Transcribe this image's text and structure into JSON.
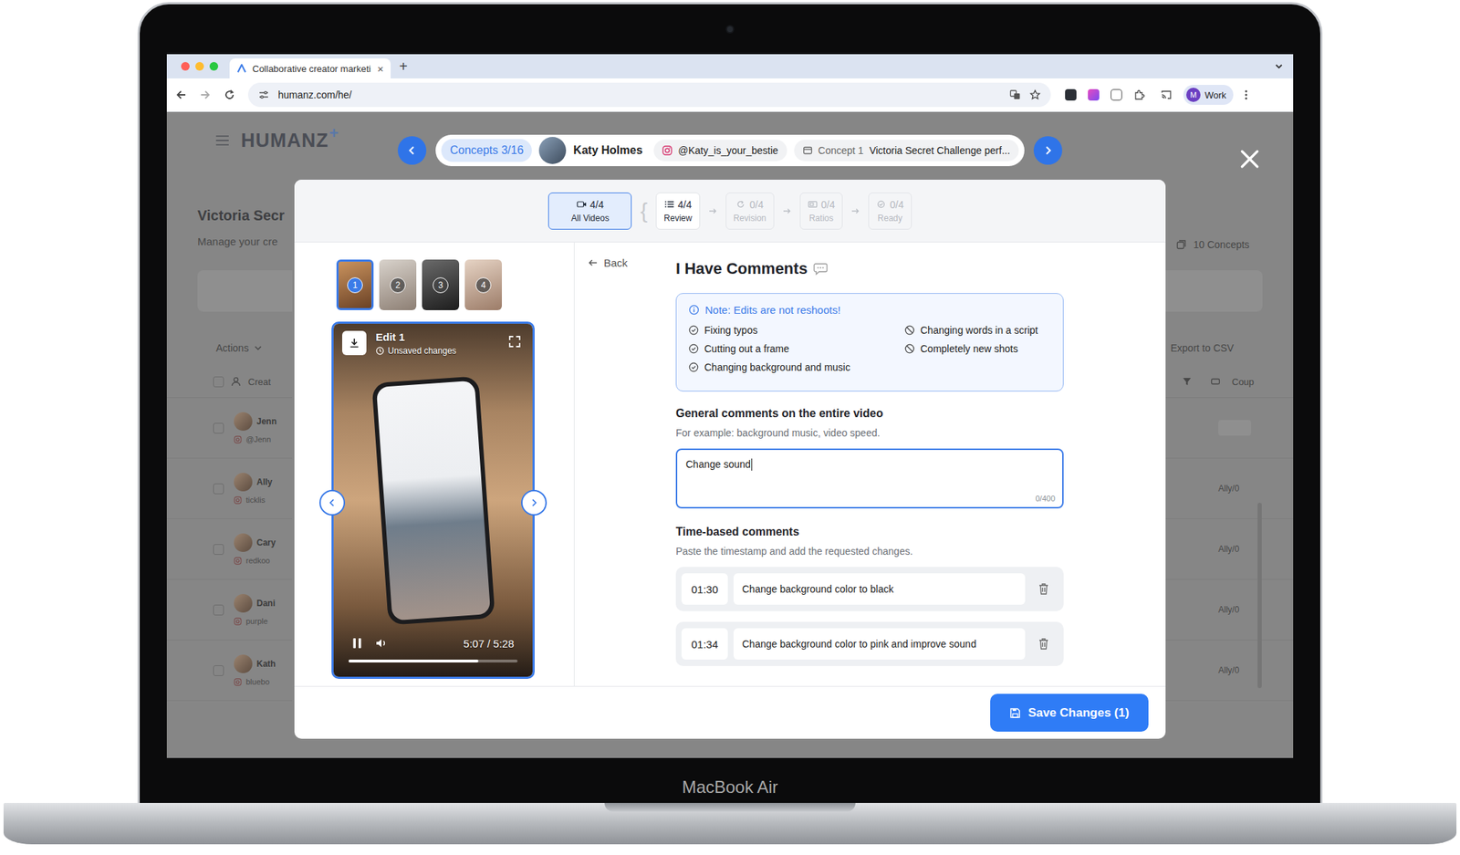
{
  "device": {
    "label": "MacBook Air"
  },
  "browser": {
    "tab": {
      "title": "Collaborative creator marketi",
      "close": "×"
    },
    "new_tab": "+",
    "url": "humanz.com/he/",
    "profile": {
      "initial": "M",
      "label": "Work"
    }
  },
  "page": {
    "logo": "HUMANZ",
    "logo_mark": "+",
    "title": "Victoria Secr",
    "subtitle": "Manage your cre",
    "actions": "Actions",
    "concepts_count": "10 Concepts",
    "export": "Export to CSV",
    "columns": [
      "Creat",
      "Coup"
    ],
    "rows": [
      {
        "name": "Jenn",
        "handle": "@Jenn",
        "coupon": ""
      },
      {
        "name": "Ally",
        "handle": "ticklis",
        "coupon": "Ally/0"
      },
      {
        "name": "Cary",
        "handle": "redkoo",
        "coupon": "Ally/0"
      },
      {
        "name": "Dani",
        "handle": "purple",
        "coupon": "Ally/0"
      },
      {
        "name": "Kath",
        "handle": "bluebo",
        "coupon": "Ally/0"
      }
    ]
  },
  "nav": {
    "counter": "Concepts 3/16",
    "creator": "Katy Holmes",
    "handle": "@Katy_is_your_bestie",
    "concept_label": "Concept 1",
    "concept_title": "Victoria Secret Challenge perf..."
  },
  "modal": {
    "steps": [
      {
        "count": "4/4",
        "label": "All Videos",
        "selected": true,
        "disabled": false
      },
      {
        "count": "4/4",
        "label": "Review",
        "selected": false,
        "disabled": false
      },
      {
        "count": "0/4",
        "label": "Revision",
        "selected": false,
        "disabled": true
      },
      {
        "count": "0/4",
        "label": "Ratios",
        "selected": false,
        "disabled": true
      },
      {
        "count": "0/4",
        "label": "Ready",
        "selected": false,
        "disabled": true
      }
    ],
    "group_mark": "{",
    "thumbnails": [
      {
        "number": "1",
        "selected": true
      },
      {
        "number": "2",
        "selected": false
      },
      {
        "number": "3",
        "selected": false
      },
      {
        "number": "4",
        "selected": false
      }
    ],
    "player": {
      "title": "Edit 1",
      "status": "Unsaved changes",
      "time": "5:07 / 5:28",
      "level": 0.77,
      "playing": true,
      "muted": false
    },
    "back": "Back",
    "title": "I Have Comments",
    "note": {
      "title": "Note: Edits are not reshoots!",
      "items": [
        {
          "text": "Fixing typos",
          "allowed": true
        },
        {
          "text": "Cutting out a frame",
          "allowed": true
        },
        {
          "text": "Changing background and music",
          "allowed": true
        },
        {
          "text": "Changing words in a script",
          "allowed": false
        },
        {
          "text": "Completely new shots",
          "allowed": false
        }
      ]
    },
    "general": {
      "label": "General comments on the entire video",
      "hint": "For example: background music, video speed.",
      "value": "Change sound",
      "counter": "0/400",
      "focused": true
    },
    "timed": {
      "label": "Time-based comments",
      "hint": "Paste the timestamp and add the requested changes.",
      "items": [
        {
          "time": "01:30",
          "text": "Change background color to black"
        },
        {
          "time": "01:34",
          "text": "Change background color to pink and improve sound"
        }
      ]
    },
    "save": "Save Changes (1)"
  }
}
